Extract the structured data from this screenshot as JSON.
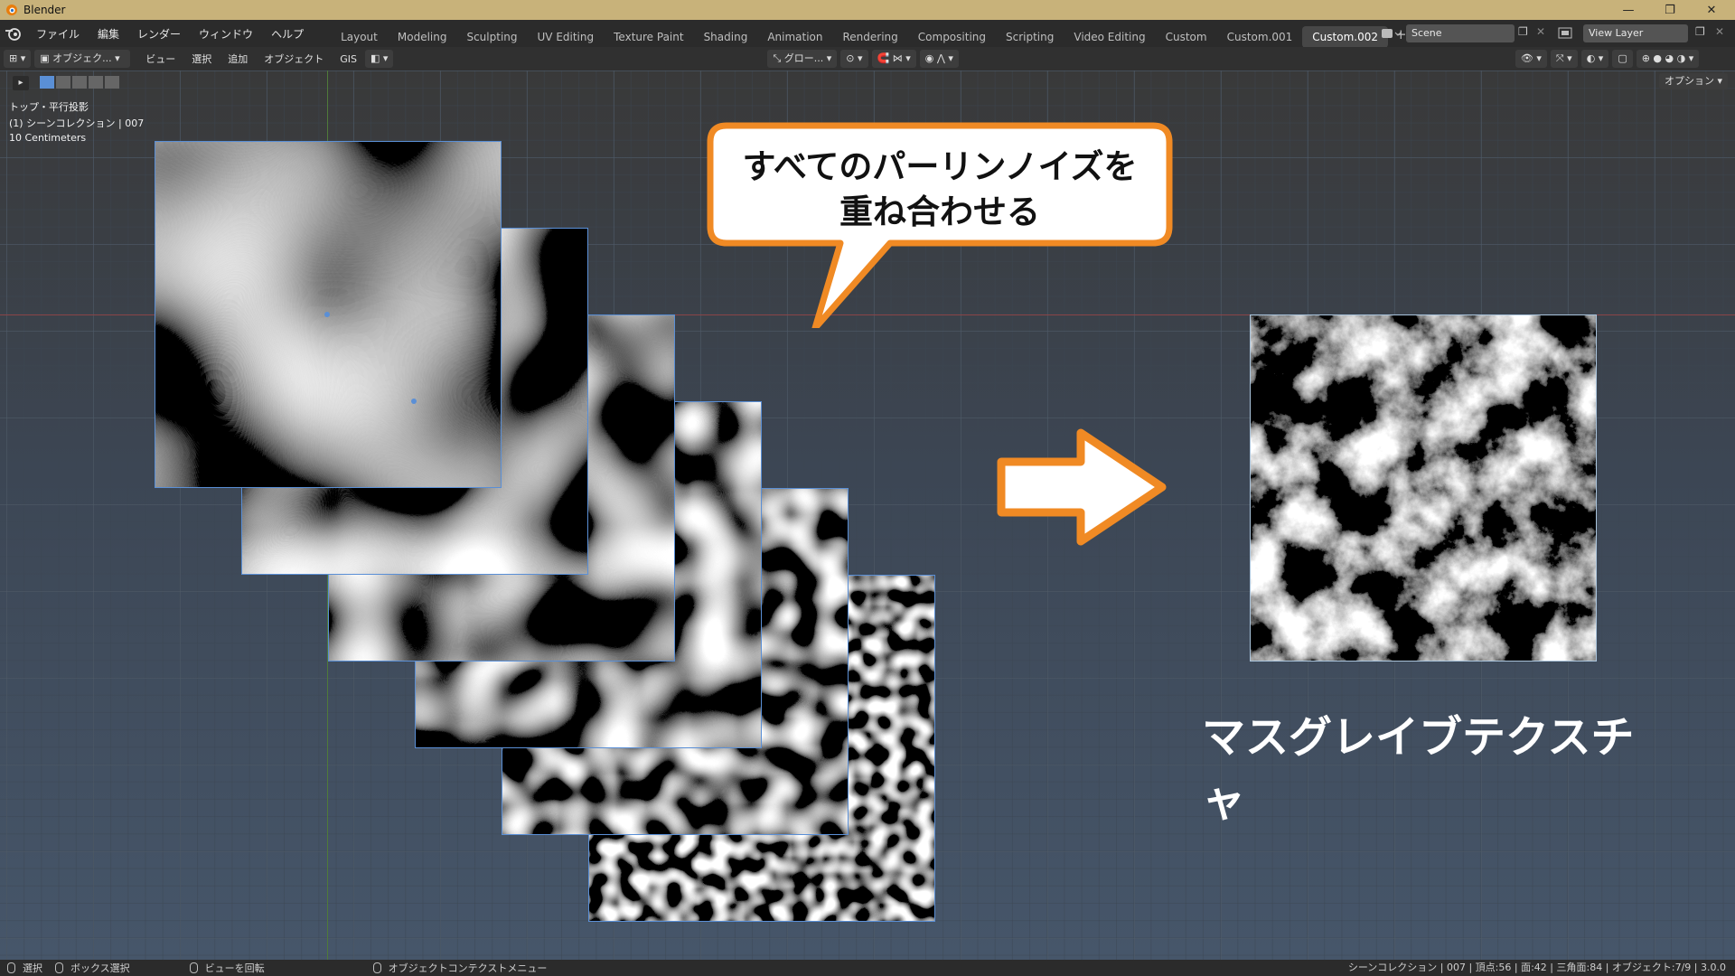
{
  "window": {
    "title": "Blender"
  },
  "menus": [
    "ファイル",
    "編集",
    "レンダー",
    "ウィンドウ",
    "ヘルプ"
  ],
  "workspaces": [
    "Layout",
    "Modeling",
    "Sculpting",
    "UV Editing",
    "Texture Paint",
    "Shading",
    "Animation",
    "Rendering",
    "Compositing",
    "Scripting",
    "Video Editing",
    "Custom",
    "Custom.001",
    "Custom.002"
  ],
  "active_workspace": "Custom.002",
  "scene": {
    "name": "Scene"
  },
  "view_layer": {
    "name": "View Layer"
  },
  "header": {
    "mode": "オブジェク...",
    "menus": [
      "ビュー",
      "選択",
      "追加",
      "オブジェクト",
      "GIS"
    ],
    "transform": "グロー...",
    "options": "オプション"
  },
  "viewport": {
    "view_name": "トップ・平行投影",
    "collection": "(1) シーンコレクション | 007",
    "scale": "10 Centimeters"
  },
  "callout": {
    "line1": "すべてのパーリンノイズを",
    "line2": "重ね合わせる"
  },
  "result_label": "マスグレイブテクスチャ",
  "statusbar": {
    "select": "選択",
    "box_select": "ボックス選択",
    "rotate": "ビューを回転",
    "context_menu": "オブジェクトコンテクストメニュー",
    "stats": "シーンコレクション | 007 | 頂点:56 | 面:42 | 三角面:84 | オブジェクト:7/9 | 3.0.0"
  },
  "colors": {
    "selection": "#5a8fd6",
    "callout_border": "#f08a24",
    "arrow_border": "#f08a24"
  }
}
